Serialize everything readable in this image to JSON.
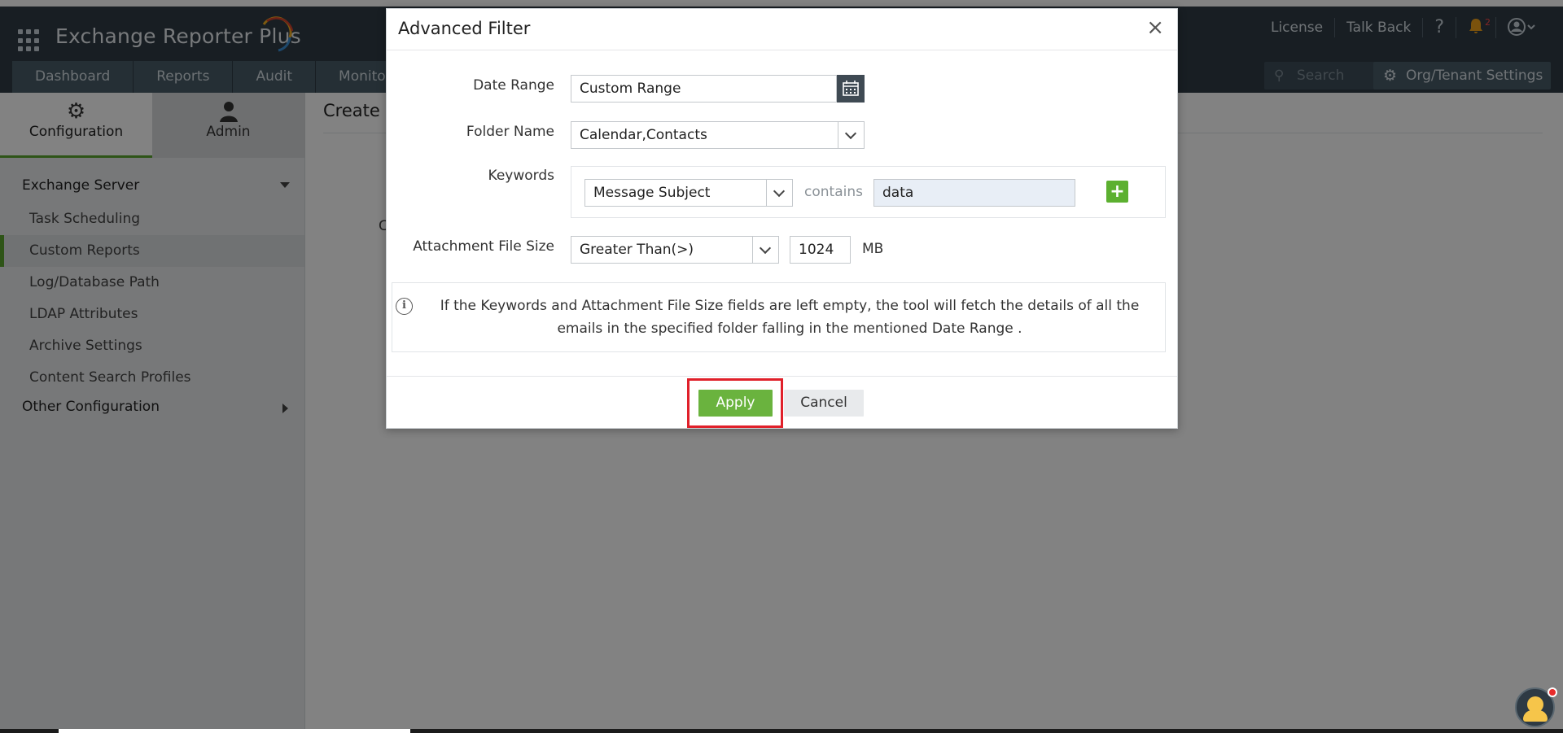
{
  "header": {
    "app_title": "Exchange Reporter Plus",
    "top_links": [
      "License",
      "Talk Back"
    ],
    "help_icon": "?",
    "notification_count": "2",
    "nav_tabs": [
      "Dashboard",
      "Reports",
      "Audit",
      "Monito"
    ],
    "search_placeholder": "Search",
    "org_settings": "Org/Tenant Settings"
  },
  "sidebar": {
    "tabs": [
      {
        "label": "Configuration",
        "icon": "gear-icon",
        "active": true
      },
      {
        "label": "Admin",
        "icon": "user-icon",
        "active": false
      }
    ],
    "group_exchange": "Exchange Server",
    "items": [
      {
        "label": "Task Scheduling",
        "active": false
      },
      {
        "label": "Custom Reports",
        "active": true
      },
      {
        "label": "Log/Database Path",
        "active": false
      },
      {
        "label": "LDAP Attributes",
        "active": false
      },
      {
        "label": "Archive Settings",
        "active": false
      },
      {
        "label": "Content Search Profiles",
        "active": false
      }
    ],
    "group_other": "Other Configuration"
  },
  "main": {
    "title_fragment": "Create C",
    "body_fragment": "C"
  },
  "modal": {
    "title": "Advanced Filter",
    "close": "×",
    "date_range_label": "Date Range",
    "date_range_value": "Custom Range",
    "folder_label": "Folder Name",
    "folder_value": "Calendar,Contacts",
    "keywords_label": "Keywords",
    "keyword_field": "Message Subject",
    "keyword_operator": "contains",
    "keyword_value": "data",
    "add_symbol": "+",
    "attachment_label": "Attachment File Size",
    "attachment_operator": "Greater Than(>)",
    "attachment_value": "1024",
    "attachment_unit": "MB",
    "info_icon": "i",
    "info_text": "If the Keywords and Attachment File Size fields are left empty, the tool will fetch the details of all the emails in the specified folder falling in the mentioned Date Range .",
    "apply_label": "Apply",
    "cancel_label": "Cancel"
  },
  "colors": {
    "header_bg": "#2f3c46",
    "accent_green": "#6ab33e",
    "highlight_red": "#e0202a"
  }
}
